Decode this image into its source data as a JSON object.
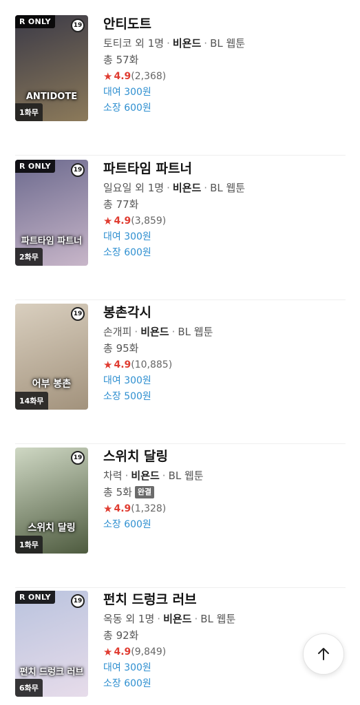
{
  "items": [
    {
      "title": "안티도트",
      "author": "토티코 외 1명",
      "publisher": "비욘드",
      "genre": "BL 웹툰",
      "episodes": "총 57화",
      "completed_badge": "",
      "score": "4.9",
      "reviews": "(2,368)",
      "prices": [
        "대여 300원",
        "소장 600원"
      ],
      "ronly": "R ONLY",
      "age": "19",
      "free": "1화무",
      "logo": "ANTIDOTE",
      "colors": [
        "#3b3a47",
        "#8c7a5a"
      ]
    },
    {
      "title": "파트타임 파트너",
      "author": "일요일 외 1명",
      "publisher": "비욘드",
      "genre": "BL 웹툰",
      "episodes": "총 77화",
      "completed_badge": "",
      "score": "4.9",
      "reviews": "(3,859)",
      "prices": [
        "대여 300원",
        "소장 600원"
      ],
      "ronly": "R ONLY",
      "age": "19",
      "free": "2화무",
      "logo": "파트타임 파트너",
      "colors": [
        "#6c6a8e",
        "#c8b6c9"
      ]
    },
    {
      "title": "봉촌각시",
      "author": "손개피",
      "publisher": "비욘드",
      "genre": "BL 웹툰",
      "episodes": "총 95화",
      "completed_badge": "",
      "score": "4.9",
      "reviews": "(10,885)",
      "prices": [
        "대여 300원",
        "소장 500원"
      ],
      "ronly": "",
      "age": "19",
      "free": "14화무",
      "logo": "어부 봉촌",
      "colors": [
        "#d9cfbf",
        "#a2927c"
      ]
    },
    {
      "title": "스위치 달링",
      "author": "차력",
      "publisher": "비욘드",
      "genre": "BL 웹툰",
      "episodes": "총 5화",
      "completed_badge": "완결",
      "score": "4.9",
      "reviews": "(1,328)",
      "prices": [
        "소장 600원"
      ],
      "ronly": "",
      "age": "19",
      "free": "1화무",
      "logo": "스위치 달링",
      "colors": [
        "#cfd8c4",
        "#4e5b3f"
      ]
    },
    {
      "title": "펀치 드렁크 러브",
      "author": "옥동 외 1명",
      "publisher": "비욘드",
      "genre": "BL 웹툰",
      "episodes": "총 92화",
      "completed_badge": "",
      "score": "4.9",
      "reviews": "(9,849)",
      "prices": [
        "대여 300원",
        "소장 600원"
      ],
      "ronly": "R ONLY",
      "age": "19",
      "free": "6화무",
      "logo": "펀치 드렁크 러브",
      "colors": [
        "#b9c3de",
        "#e7dcea"
      ]
    }
  ],
  "scroll_top_icon": "arrow-up-icon",
  "accent_color": "#2e8fd0",
  "star_color": "#e03c31"
}
